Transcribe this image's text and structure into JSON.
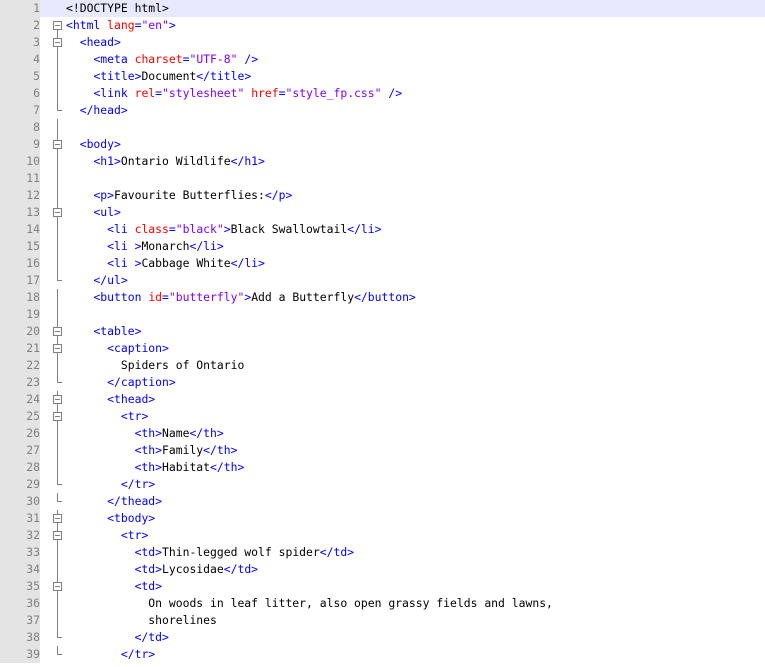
{
  "editor": {
    "lines": [
      {
        "n": "1",
        "fold": "none",
        "active": true,
        "indent": 0,
        "segs": [
          [
            "<!DOCTYPE html>",
            "doc"
          ]
        ]
      },
      {
        "n": "2",
        "fold": "open",
        "indent": 0,
        "segs": [
          [
            "<html ",
            "t"
          ],
          [
            "lang",
            "a"
          ],
          [
            "=",
            "t"
          ],
          [
            "\"en\"",
            "v"
          ],
          [
            ">",
            "t"
          ]
        ]
      },
      {
        "n": "3",
        "fold": "open",
        "indent": 2,
        "segs": [
          [
            "<head>",
            "t"
          ]
        ]
      },
      {
        "n": "4",
        "fold": "line",
        "indent": 4,
        "segs": [
          [
            "<meta ",
            "t"
          ],
          [
            "charset",
            "a"
          ],
          [
            "=",
            "t"
          ],
          [
            "\"UTF-8\"",
            "v"
          ],
          [
            " />",
            "t"
          ]
        ]
      },
      {
        "n": "5",
        "fold": "line",
        "indent": 4,
        "segs": [
          [
            "<title>",
            "t"
          ],
          [
            "Document",
            "x"
          ],
          [
            "</title>",
            "t"
          ]
        ]
      },
      {
        "n": "6",
        "fold": "line",
        "indent": 4,
        "segs": [
          [
            "<link ",
            "t"
          ],
          [
            "rel",
            "a"
          ],
          [
            "=",
            "t"
          ],
          [
            "\"stylesheet\"",
            "v"
          ],
          [
            " ",
            "t"
          ],
          [
            "href",
            "a"
          ],
          [
            "=",
            "t"
          ],
          [
            "\"style_fp.css\"",
            "v"
          ],
          [
            " />",
            "t"
          ]
        ]
      },
      {
        "n": "7",
        "fold": "end",
        "indent": 2,
        "segs": [
          [
            "</head>",
            "t"
          ]
        ]
      },
      {
        "n": "8",
        "fold": "line",
        "indent": 0,
        "segs": []
      },
      {
        "n": "9",
        "fold": "open",
        "indent": 2,
        "segs": [
          [
            "<body>",
            "t"
          ]
        ]
      },
      {
        "n": "10",
        "fold": "line",
        "indent": 4,
        "segs": [
          [
            "<h1>",
            "t"
          ],
          [
            "Ontario Wildlife",
            "x"
          ],
          [
            "</h1>",
            "t"
          ]
        ]
      },
      {
        "n": "11",
        "fold": "line",
        "indent": 0,
        "segs": []
      },
      {
        "n": "12",
        "fold": "line",
        "indent": 4,
        "segs": [
          [
            "<p>",
            "t"
          ],
          [
            "Favourite Butterflies:",
            "x"
          ],
          [
            "</p>",
            "t"
          ]
        ]
      },
      {
        "n": "13",
        "fold": "open",
        "indent": 4,
        "segs": [
          [
            "<ul>",
            "t"
          ]
        ]
      },
      {
        "n": "14",
        "fold": "line",
        "indent": 6,
        "segs": [
          [
            "<li ",
            "t"
          ],
          [
            "class",
            "a"
          ],
          [
            "=",
            "t"
          ],
          [
            "\"black\"",
            "v"
          ],
          [
            ">",
            "t"
          ],
          [
            "Black Swallowtail",
            "x"
          ],
          [
            "</li>",
            "t"
          ]
        ]
      },
      {
        "n": "15",
        "fold": "line",
        "indent": 6,
        "segs": [
          [
            "<li >",
            "t"
          ],
          [
            "Monarch",
            "x"
          ],
          [
            "</li>",
            "t"
          ]
        ]
      },
      {
        "n": "16",
        "fold": "line",
        "indent": 6,
        "segs": [
          [
            "<li >",
            "t"
          ],
          [
            "Cabbage White",
            "x"
          ],
          [
            "</li>",
            "t"
          ]
        ]
      },
      {
        "n": "17",
        "fold": "end",
        "indent": 4,
        "segs": [
          [
            "</ul>",
            "t"
          ]
        ]
      },
      {
        "n": "18",
        "fold": "line",
        "indent": 4,
        "segs": [
          [
            "<button ",
            "t"
          ],
          [
            "id",
            "a"
          ],
          [
            "=",
            "t"
          ],
          [
            "\"butterfly\"",
            "v"
          ],
          [
            ">",
            "t"
          ],
          [
            "Add a Butterfly",
            "x"
          ],
          [
            "</button>",
            "t"
          ]
        ]
      },
      {
        "n": "19",
        "fold": "line",
        "indent": 0,
        "segs": []
      },
      {
        "n": "20",
        "fold": "open",
        "indent": 4,
        "segs": [
          [
            "<table>",
            "t"
          ]
        ]
      },
      {
        "n": "21",
        "fold": "open",
        "indent": 6,
        "segs": [
          [
            "<caption>",
            "t"
          ]
        ]
      },
      {
        "n": "22",
        "fold": "line",
        "indent": 8,
        "segs": [
          [
            "Spiders of Ontario",
            "x"
          ]
        ]
      },
      {
        "n": "23",
        "fold": "end",
        "indent": 6,
        "segs": [
          [
            "</caption>",
            "t"
          ]
        ]
      },
      {
        "n": "24",
        "fold": "open",
        "indent": 6,
        "segs": [
          [
            "<thead>",
            "t"
          ]
        ]
      },
      {
        "n": "25",
        "fold": "open",
        "indent": 8,
        "segs": [
          [
            "<tr>",
            "t"
          ]
        ]
      },
      {
        "n": "26",
        "fold": "line",
        "indent": 10,
        "segs": [
          [
            "<th>",
            "t"
          ],
          [
            "Name",
            "x"
          ],
          [
            "</th>",
            "t"
          ]
        ]
      },
      {
        "n": "27",
        "fold": "line",
        "indent": 10,
        "segs": [
          [
            "<th>",
            "t"
          ],
          [
            "Family",
            "x"
          ],
          [
            "</th>",
            "t"
          ]
        ]
      },
      {
        "n": "28",
        "fold": "line",
        "indent": 10,
        "segs": [
          [
            "<th>",
            "t"
          ],
          [
            "Habitat",
            "x"
          ],
          [
            "</th>",
            "t"
          ]
        ]
      },
      {
        "n": "29",
        "fold": "end",
        "indent": 8,
        "segs": [
          [
            "</tr>",
            "t"
          ]
        ]
      },
      {
        "n": "30",
        "fold": "end",
        "indent": 6,
        "segs": [
          [
            "</thead>",
            "t"
          ]
        ]
      },
      {
        "n": "31",
        "fold": "open",
        "indent": 6,
        "segs": [
          [
            "<tbody>",
            "t"
          ]
        ]
      },
      {
        "n": "32",
        "fold": "open",
        "indent": 8,
        "segs": [
          [
            "<tr>",
            "t"
          ]
        ]
      },
      {
        "n": "33",
        "fold": "line",
        "indent": 10,
        "segs": [
          [
            "<td>",
            "t"
          ],
          [
            "Thin-legged wolf spider",
            "x"
          ],
          [
            "</td>",
            "t"
          ]
        ]
      },
      {
        "n": "34",
        "fold": "line",
        "indent": 10,
        "segs": [
          [
            "<td>",
            "t"
          ],
          [
            "Lycosidae",
            "x"
          ],
          [
            "</td>",
            "t"
          ]
        ]
      },
      {
        "n": "35",
        "fold": "open",
        "indent": 10,
        "segs": [
          [
            "<td>",
            "t"
          ]
        ]
      },
      {
        "n": "36",
        "fold": "line",
        "indent": 12,
        "segs": [
          [
            "On woods in leaf litter, also open grassy fields and lawns,",
            "x"
          ]
        ]
      },
      {
        "n": "37",
        "fold": "line",
        "indent": 12,
        "segs": [
          [
            "shorelines",
            "x"
          ]
        ]
      },
      {
        "n": "38",
        "fold": "end",
        "indent": 10,
        "segs": [
          [
            "</td>",
            "t"
          ]
        ]
      },
      {
        "n": "39",
        "fold": "end",
        "indent": 8,
        "segs": [
          [
            "</tr>",
            "t"
          ]
        ]
      }
    ]
  }
}
